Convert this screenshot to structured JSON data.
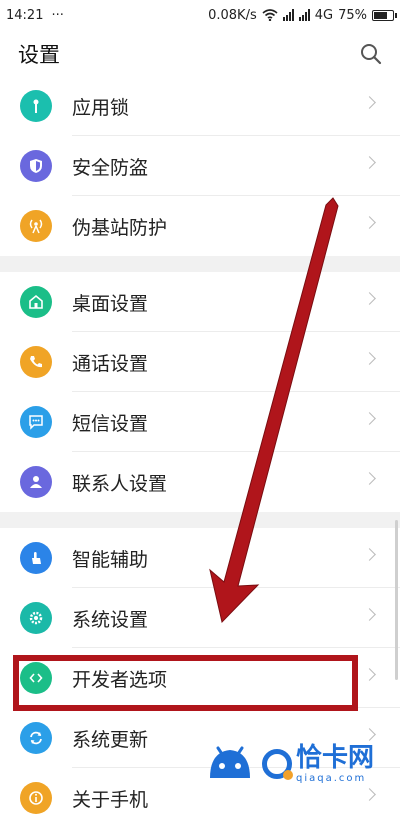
{
  "status": {
    "time": "14:21",
    "dots": "···",
    "speed": "0.08K/s",
    "network": "4G",
    "battery": "75%",
    "battery_level": 0.75
  },
  "header": {
    "title": "设置"
  },
  "groups": [
    {
      "items": [
        {
          "label": "应用锁",
          "icon": "key-icon",
          "color": "#1bbfae"
        },
        {
          "label": "安全防盗",
          "icon": "shield-icon",
          "color": "#6a68de"
        },
        {
          "label": "伪基站防护",
          "icon": "antenna-icon",
          "color": "#f0a426"
        }
      ]
    },
    {
      "items": [
        {
          "label": "桌面设置",
          "icon": "home-icon",
          "color": "#1bbe88"
        },
        {
          "label": "通话设置",
          "icon": "phone-icon",
          "color": "#f0a426"
        },
        {
          "label": "短信设置",
          "icon": "message-icon",
          "color": "#2b9fe8"
        },
        {
          "label": "联系人设置",
          "icon": "contact-icon",
          "color": "#6a68de"
        }
      ]
    },
    {
      "items": [
        {
          "label": "智能辅助",
          "icon": "hand-icon",
          "color": "#2b84e8"
        },
        {
          "label": "系统设置",
          "icon": "gear-icon",
          "color": "#1bb9a8"
        },
        {
          "label": "开发者选项",
          "icon": "code-icon",
          "color": "#1bbe88"
        },
        {
          "label": "系统更新",
          "icon": "sync-icon",
          "color": "#2b9fe8"
        },
        {
          "label": "关于手机",
          "icon": "info-icon",
          "color": "#f0a426"
        }
      ]
    }
  ],
  "watermark": {
    "name": "恰卡网",
    "domain": "qiaqa.com"
  },
  "colors": {
    "annotation": "#b0151b"
  }
}
